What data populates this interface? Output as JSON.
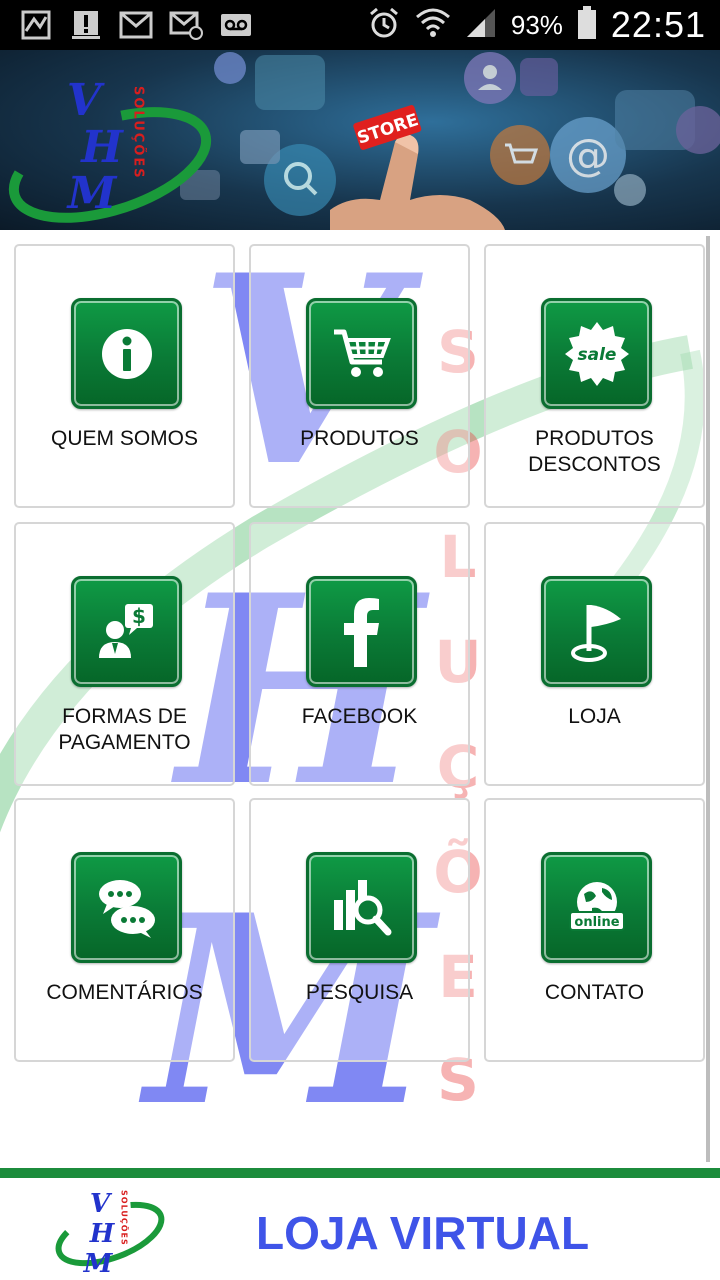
{
  "status_bar": {
    "battery_percent": "93%",
    "time": "22:51",
    "icons": [
      "app-icon",
      "alert-icon",
      "gmail-icon",
      "email-icon",
      "voicemail-icon",
      "alarm-icon",
      "wifi-icon",
      "signal-icon",
      "battery-icon"
    ]
  },
  "banner": {
    "logo_letters": [
      "V",
      "H",
      "M"
    ],
    "logo_side_text": "SOLUÇÕES",
    "sign_text": "STORE"
  },
  "tiles": [
    {
      "label": "QUEM SOMOS",
      "icon": "info-icon"
    },
    {
      "label": "PRODUTOS",
      "icon": "cart-icon"
    },
    {
      "label": "PRODUTOS DESCONTOS",
      "icon": "sale-icon",
      "icon_text": "sale"
    },
    {
      "label": "FORMAS DE PAGAMENTO",
      "icon": "payment-icon"
    },
    {
      "label": "FACEBOOK",
      "icon": "facebook-icon"
    },
    {
      "label": "LOJA",
      "icon": "flag-icon"
    },
    {
      "label": "COMENTÁRIOS",
      "icon": "comments-icon"
    },
    {
      "label": "PESQUISA",
      "icon": "search-chart-icon"
    },
    {
      "label": "CONTATO",
      "icon": "globe-online-icon",
      "icon_text": "online"
    }
  ],
  "watermark": {
    "letters": [
      "V",
      "H",
      "M"
    ],
    "side_letters": [
      "S",
      "O",
      "L",
      "U",
      "Ç",
      "Õ",
      "E",
      "S"
    ]
  },
  "footer": {
    "title": "LOJA VIRTUAL",
    "logo_letters": [
      "V",
      "H",
      "M"
    ],
    "logo_side_text": "SOLUÇÕES"
  },
  "colors": {
    "tile_green": "#0a7a36",
    "footer_line": "#1c8c3c",
    "footer_title": "#3f54e8",
    "logo_blue": "#2233cc",
    "logo_green": "#1a9a3a",
    "logo_red": "#d81e1e"
  }
}
